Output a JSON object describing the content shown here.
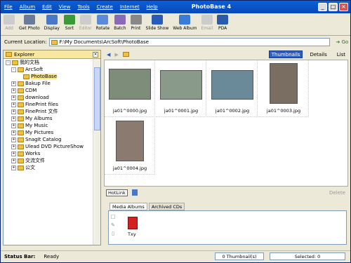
{
  "window": {
    "title": "PhotoBase 4"
  },
  "menu": [
    "File",
    "Album",
    "Edit",
    "View",
    "Tools",
    "Create",
    "Internet",
    "Help"
  ],
  "toolbar": [
    {
      "label": "Add",
      "disabled": true
    },
    {
      "label": "Get Photo",
      "disabled": false
    },
    {
      "label": "Display",
      "disabled": false
    },
    {
      "label": "Sort",
      "disabled": false
    },
    {
      "label": "Editor",
      "disabled": true
    },
    {
      "label": "Rotate",
      "disabled": false
    },
    {
      "label": "Batch",
      "disabled": false
    },
    {
      "label": "Print",
      "disabled": false
    },
    {
      "label": "Slide Show",
      "disabled": false
    },
    {
      "label": "Web Album",
      "disabled": false
    },
    {
      "label": "Email",
      "disabled": true
    },
    {
      "label": "PDA",
      "disabled": false
    }
  ],
  "location": {
    "label": "Current Location:",
    "path": "F:\\My Documents\\ArcSoft\\PhotoBase",
    "go": "Go"
  },
  "explorer": {
    "title": "Explorer",
    "items": [
      {
        "label": "我的文档",
        "level": 0,
        "expand": "-"
      },
      {
        "label": "ArcSoft",
        "level": 1,
        "expand": "-"
      },
      {
        "label": "PhotoBase",
        "level": 2,
        "expand": "",
        "selected": true
      },
      {
        "label": "Bakup File",
        "level": 1,
        "expand": "+"
      },
      {
        "label": "CDM",
        "level": 1,
        "expand": "+"
      },
      {
        "label": "download",
        "level": 1,
        "expand": "+"
      },
      {
        "label": "FinePrint files",
        "level": 1,
        "expand": "+"
      },
      {
        "label": "FinePrint 文件",
        "level": 1,
        "expand": "+"
      },
      {
        "label": "My Albums",
        "level": 1,
        "expand": "+"
      },
      {
        "label": "My Music",
        "level": 1,
        "expand": "+"
      },
      {
        "label": "My Pictures",
        "level": 1,
        "expand": "+"
      },
      {
        "label": "SnagIt Catalog",
        "level": 1,
        "expand": "+"
      },
      {
        "label": "Ulead DVD PictureShow",
        "level": 1,
        "expand": "+"
      },
      {
        "label": "Works",
        "level": 1,
        "expand": "+"
      },
      {
        "label": "交流文件",
        "level": 1,
        "expand": "+"
      },
      {
        "label": "公文",
        "level": 1,
        "expand": "+"
      }
    ]
  },
  "views": {
    "thumbnails": "Thumbnails",
    "details": "Details",
    "list": "List"
  },
  "photos": [
    "ja01^0000.jpg",
    "ja01^0001.jpg",
    "ja01^0002.jpg",
    "ja01^0003.jpg",
    "ja01^0004.jpg"
  ],
  "hotlink": "HotLink",
  "delete": "Delete",
  "album_tabs": [
    "Media Albums",
    "Archived CDs"
  ],
  "album": {
    "name": "Txy",
    "color": "#d42020"
  },
  "status": {
    "label": "Status Bar:",
    "text": "Ready",
    "count": "0 Thumbnail(s)",
    "selected": "Selected: 0"
  }
}
